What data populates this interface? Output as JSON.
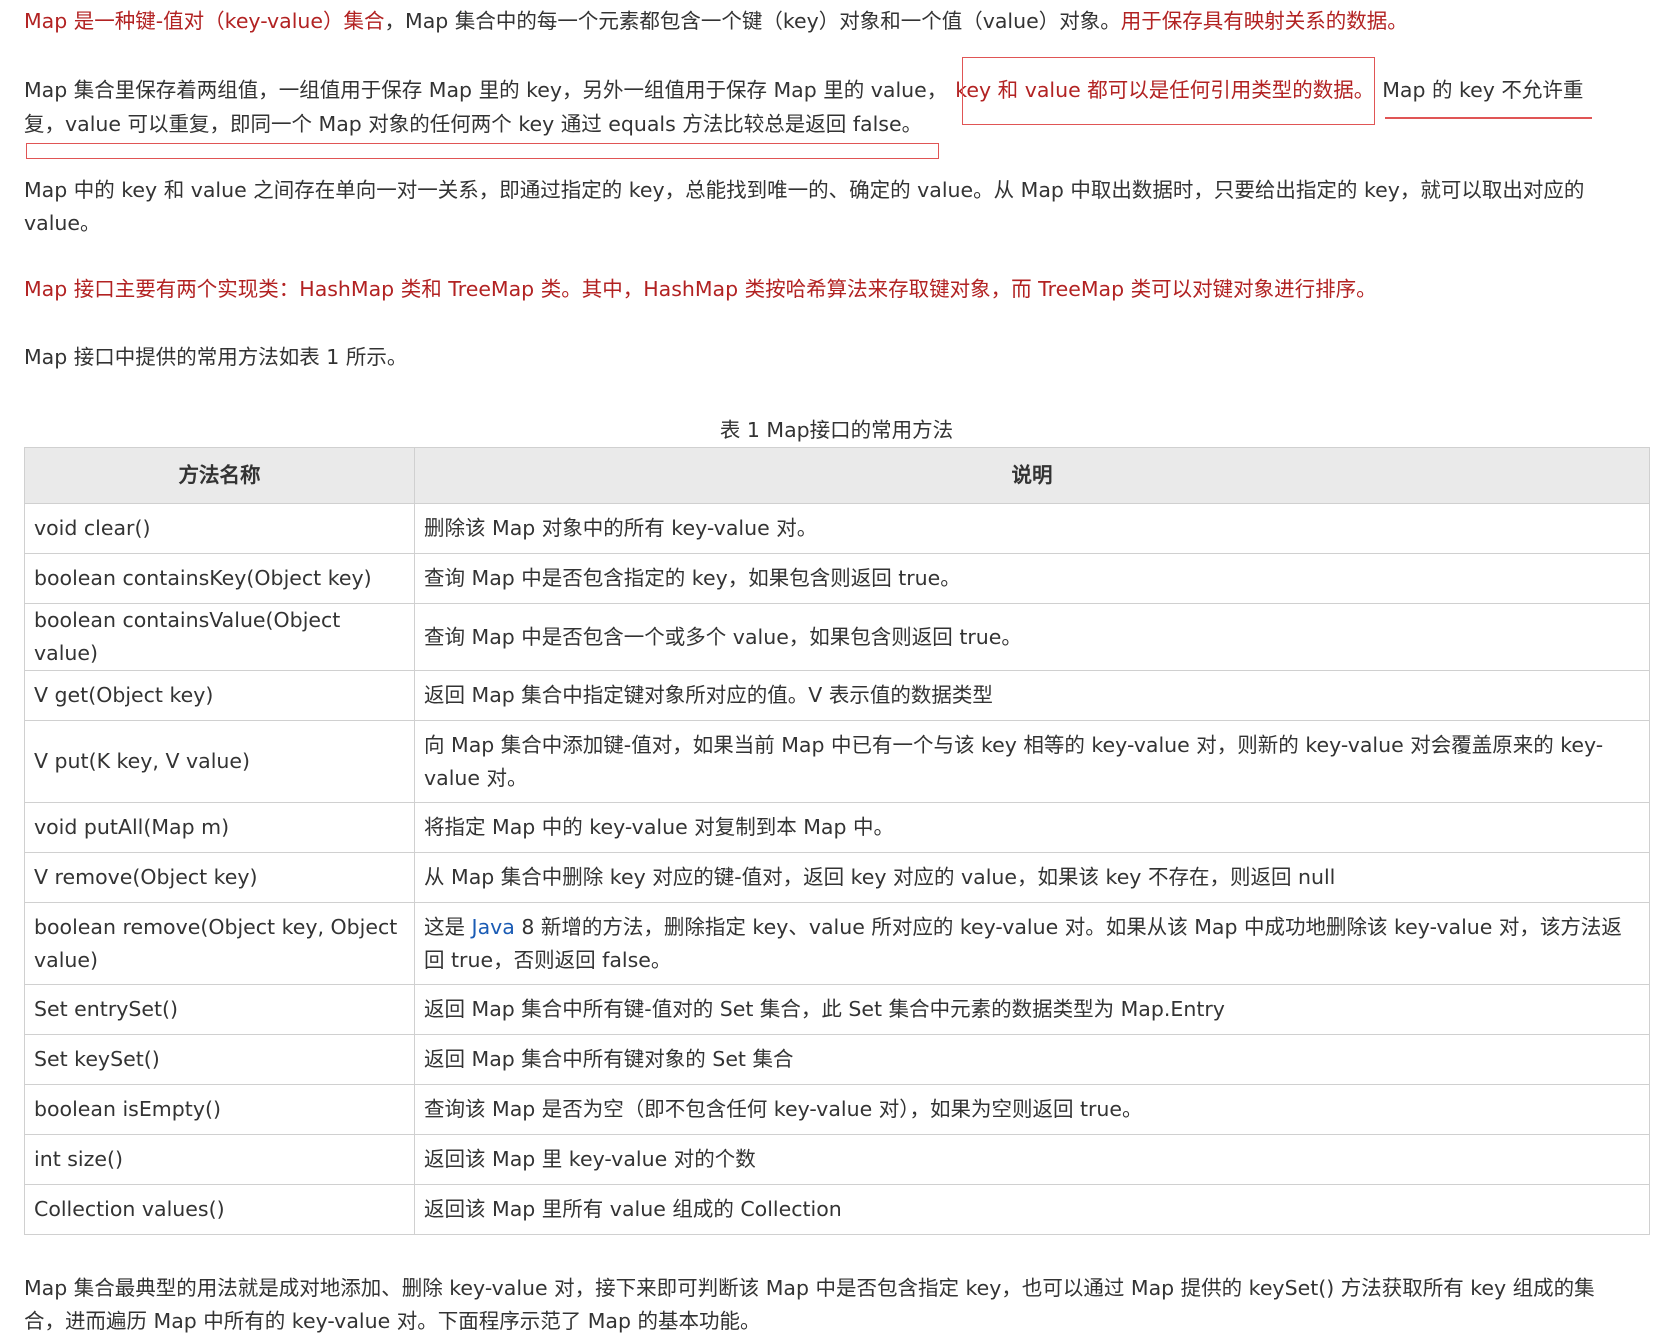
{
  "paragraphs": {
    "p1_red": "Map 是一种键-值对（key-value）集合",
    "p1_plain": "，Map 集合中的每一个元素都包含一个键（key）对象和一个值（value）对象。",
    "p1_red2": "用于保存具有映射关系的数据。",
    "p2_line1_a": "Map 集合里保存着两组值，一组值用于保存 Map 里的 key，另外一组值用于保存 Map 里的 value，",
    "p2_line1_red": "key 和 value 都可以是任何引用类型的数据。",
    "p2_line1_b": "Map 的 key 不允许重",
    "p2_line2": "复，value 可以重复，即同一个 Map 对象的任何两个 key 通过 equals 方法比较总是返回 false。",
    "p3_line1": "Map 中的 key 和 value 之间存在单向一对一关系，即通过指定的 key，总能找到唯一的、确定的 value。从 Map 中取出数据时，只要给出指定的 key，就可以取出对应的",
    "p3_line2": "value。",
    "p4_red": "Map 接口主要有两个实现类：HashMap 类和 TreeMap 类。其中，HashMap 类按哈希算法来存取键对象，而 TreeMap 类可以对键对象进行排序。",
    "p5": "Map 接口中提供的常用方法如表 1 所示。",
    "p6_line1": "Map 集合最典型的用法就是成对地添加、删除 key-value 对，接下来即可判断该 Map 中是否包含指定 key，也可以通过 Map 提供的 keySet() 方法获取所有 key 组成的集",
    "p6_line2": "合，进而遍历 Map 中所有的 key-value 对。下面程序示范了 Map 的基本功能。"
  },
  "table": {
    "caption": "表 1 Map接口的常用方法",
    "headers": [
      "方法名称",
      "说明"
    ],
    "rows": [
      {
        "method": "void clear()",
        "desc": "删除该 Map 对象中的所有 key-value 对。"
      },
      {
        "method": "boolean containsKey(Object key)",
        "desc": "查询 Map 中是否包含指定的 key，如果包含则返回 true。"
      },
      {
        "method": "boolean containsValue(Object value)",
        "desc": "查询 Map 中是否包含一个或多个 value，如果包含则返回 true。"
      },
      {
        "method": "V get(Object key)",
        "desc": "返回 Map 集合中指定键对象所对应的值。V 表示值的数据类型"
      },
      {
        "method": "V put(K key, V value)",
        "desc": "向 Map 集合中添加键-值对，如果当前 Map 中已有一个与该 key 相等的 key-value 对，则新的 key-value 对会覆盖原来的 key-value 对。"
      },
      {
        "method": "void putAll(Map m)",
        "desc": "将指定 Map 中的 key-value 对复制到本 Map 中。"
      },
      {
        "method": "V remove(Object key)",
        "desc": "从 Map 集合中删除 key 对应的键-值对，返回 key 对应的 value，如果该 key 不存在，则返回 null"
      },
      {
        "method": "boolean remove(Object key, Object value)",
        "desc_a": "这是 ",
        "desc_link": "Java",
        "desc_b": " 8 新增的方法，删除指定 key、value 所对应的 key-value 对。如果从该 Map 中成功地删除该 key-value 对，该方法返回 true，否则返回 false。"
      },
      {
        "method": "Set entrySet()",
        "desc": "返回 Map 集合中所有键-值对的 Set 集合，此 Set 集合中元素的数据类型为 Map.Entry"
      },
      {
        "method": "Set keySet()",
        "desc": "返回 Map 集合中所有键对象的 Set 集合"
      },
      {
        "method": "boolean isEmpty()",
        "desc": "查询该 Map 是否为空（即不包含任何 key-value 对），如果为空则返回 true。"
      },
      {
        "method": "int size()",
        "desc": "返回该 Map 里 key-value 对的个数"
      },
      {
        "method": "Collection values()",
        "desc": "返回该 Map 里所有 value 组成的 Collection"
      }
    ]
  },
  "colors": {
    "red_text": "#b22222",
    "annotation_red": "#e05555",
    "link_blue": "#1a5bb4",
    "header_bg": "#eaeaea"
  }
}
